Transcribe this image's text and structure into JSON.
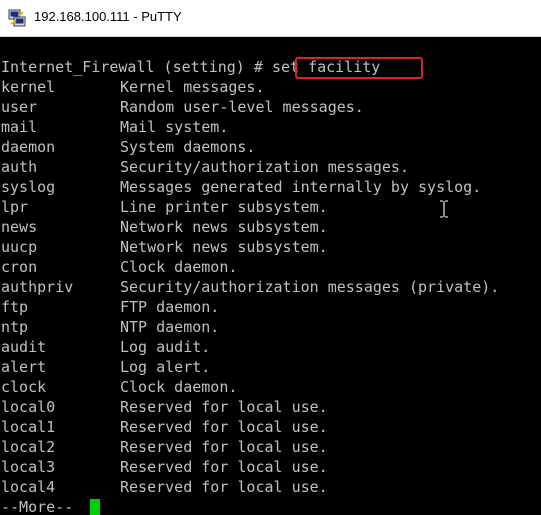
{
  "window": {
    "title": "192.168.100.111 - PuTTY",
    "icon": "putty-icon"
  },
  "terminal": {
    "prompt": "Internet_Firewall (setting) # ",
    "command": "set facility",
    "rows": [
      {
        "name": "kernel",
        "desc": "Kernel messages."
      },
      {
        "name": "user",
        "desc": "Random user-level messages."
      },
      {
        "name": "mail",
        "desc": "Mail system."
      },
      {
        "name": "daemon",
        "desc": "System daemons."
      },
      {
        "name": "auth",
        "desc": "Security/authorization messages."
      },
      {
        "name": "syslog",
        "desc": "Messages generated internally by syslog."
      },
      {
        "name": "lpr",
        "desc": "Line printer subsystem."
      },
      {
        "name": "news",
        "desc": "Network news subsystem."
      },
      {
        "name": "uucp",
        "desc": "Network news subsystem."
      },
      {
        "name": "cron",
        "desc": "Clock daemon."
      },
      {
        "name": "authpriv",
        "desc": "Security/authorization messages (private)."
      },
      {
        "name": "ftp",
        "desc": "FTP daemon."
      },
      {
        "name": "ntp",
        "desc": "NTP daemon."
      },
      {
        "name": "audit",
        "desc": "Log audit."
      },
      {
        "name": "alert",
        "desc": "Log alert."
      },
      {
        "name": "clock",
        "desc": "Clock daemon."
      },
      {
        "name": "local0",
        "desc": "Reserved for local use."
      },
      {
        "name": "local1",
        "desc": "Reserved for local use."
      },
      {
        "name": "local2",
        "desc": "Reserved for local use."
      },
      {
        "name": "local3",
        "desc": "Reserved for local use."
      },
      {
        "name": "local4",
        "desc": "Reserved for local use."
      }
    ],
    "more_prompt": "--More-- ",
    "colors": {
      "background": "#000000",
      "text": "#c0c0c0",
      "cursor": "#00d000",
      "highlight_box": "#e0202a"
    }
  }
}
